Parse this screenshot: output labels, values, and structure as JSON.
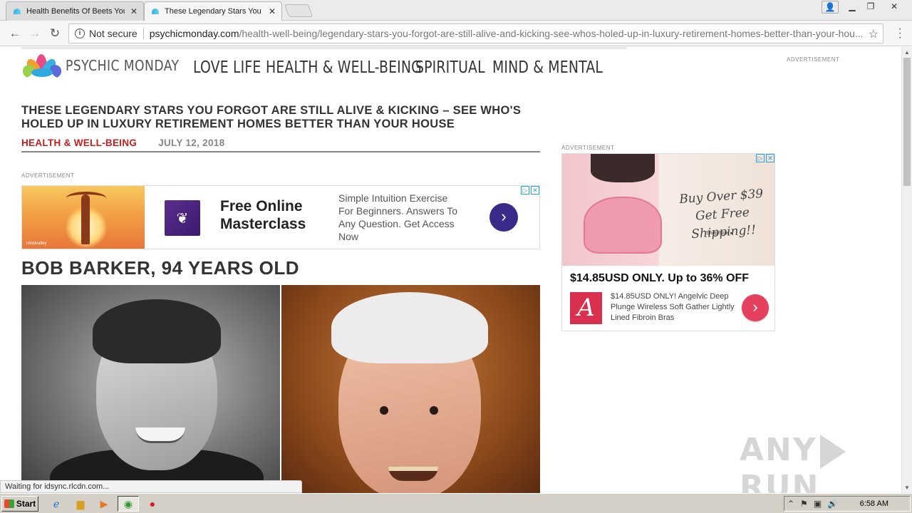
{
  "browser": {
    "tabs": [
      {
        "title": "Health Benefits Of Beets You"
      },
      {
        "title": "These Legendary Stars You"
      }
    ],
    "security_label": "Not secure",
    "url_domain": "psychicmonday.com",
    "url_path": "/health-well-being/legendary-stars-you-forgot-are-still-alive-and-kicking-see-whos-holed-up-in-luxury-retirement-homes-better-than-your-hou...",
    "status_text": "Waiting for idsync.rlcdn.com..."
  },
  "site": {
    "logo_text": "PSYCHIC MONDAY",
    "nav": [
      "LOVE LIFE",
      "HEALTH & WELL-BEING",
      "SPIRITUAL",
      "MIND & MENTAL"
    ]
  },
  "article": {
    "headline": "THESE LEGENDARY STARS YOU FORGOT ARE STILL ALIVE & KICKING – SEE WHO'S HOLED UP IN LUXURY RETIREMENT HOMES BETTER THAN YOUR HOUSE",
    "category": "HEALTH & WELL-BEING",
    "date": "JULY 12, 2018",
    "section_title": "BOB BARKER, 94 YEARS OLD"
  },
  "ads": {
    "label": "ADVERTISEMENT",
    "inline": {
      "brand": "mindvalley",
      "title": "Free Online Masterclass",
      "description": "Simple Intuition Exercise For Beginners. Answers To Any Question. Get Access Now",
      "arrow": "›"
    },
    "sidebar": {
      "banner_text": "Buy Over $39 Get Free Shipping!!",
      "shop_now": "Shop Now ▸",
      "price": "$14.85USD ONLY. Up to 36% OFF",
      "description": "$14.85USD ONLY! Angelvic Deep Plunge Wireless Soft Gather Lightly Lined Fibroin Bras",
      "logo_letter": "A",
      "arrow": "›"
    }
  },
  "watermark": {
    "left": "ANY",
    "right": "RUN"
  },
  "taskbar": {
    "start_label": "Start",
    "clock": "6:58 AM"
  },
  "colors": {
    "accent_red": "#c0201f",
    "ad_arrow_purple": "#3a2a8a",
    "ad_arrow_pink": "#e5405e"
  }
}
